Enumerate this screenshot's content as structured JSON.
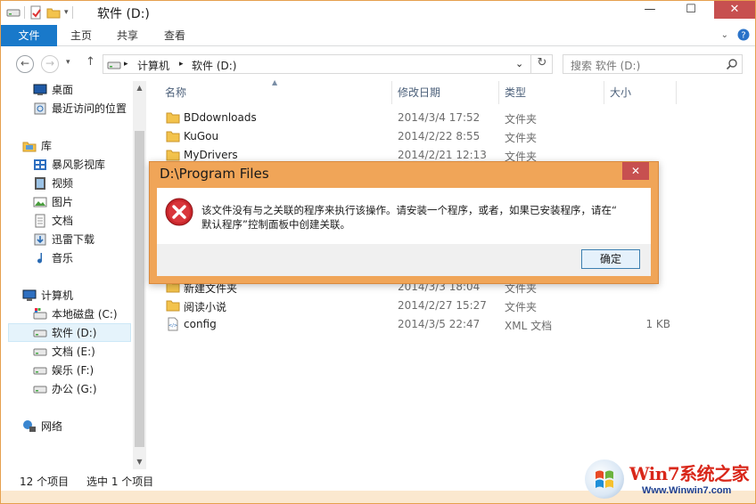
{
  "window": {
    "title": "软件 (D:)",
    "minimize_glyph": "—",
    "maximize_glyph": "☐",
    "close_glyph": "✕"
  },
  "ribbon": {
    "file_tab": "文件",
    "tabs": [
      "主页",
      "共享",
      "查看"
    ]
  },
  "address": {
    "path": [
      "计算机",
      "软件 (D:)"
    ],
    "search_placeholder": "搜索 软件 (D:)"
  },
  "nav": {
    "favorites": [
      {
        "label": "桌面",
        "icon": "desktop-icon"
      },
      {
        "label": "最近访问的位置",
        "icon": "recent-places-icon"
      }
    ],
    "library_header": "库",
    "libraries": [
      {
        "label": "暴风影视库",
        "icon": "video-library-icon"
      },
      {
        "label": "视频",
        "icon": "videos-icon"
      },
      {
        "label": "图片",
        "icon": "pictures-icon"
      },
      {
        "label": "文档",
        "icon": "documents-icon"
      },
      {
        "label": "迅雷下载",
        "icon": "downloads-icon"
      },
      {
        "label": "音乐",
        "icon": "music-icon"
      }
    ],
    "computer_header": "计算机",
    "drives": [
      {
        "label": "本地磁盘 (C:)",
        "icon": "system-drive-icon"
      },
      {
        "label": "软件 (D:)",
        "icon": "drive-icon",
        "selected": true
      },
      {
        "label": "文档 (E:)",
        "icon": "drive-icon"
      },
      {
        "label": "娱乐 (F:)",
        "icon": "drive-icon"
      },
      {
        "label": "办公 (G:)",
        "icon": "drive-icon"
      }
    ],
    "network_header": "网络"
  },
  "columns": {
    "name": "名称",
    "date": "修改日期",
    "type": "类型",
    "size": "大小"
  },
  "files": [
    {
      "name": "BDdownloads",
      "date": "2014/3/4 17:52",
      "type": "文件夹",
      "size": "",
      "icon": "folder-icon"
    },
    {
      "name": "KuGou",
      "date": "2014/2/22 8:55",
      "type": "文件夹",
      "size": "",
      "icon": "folder-icon"
    },
    {
      "name": "MyDrivers",
      "date": "2014/2/21 12:13",
      "type": "文件夹",
      "size": "",
      "icon": "folder-icon"
    },
    {
      "name": "新建文件夹",
      "date": "2014/3/3 18:04",
      "type": "文件夹",
      "size": "",
      "icon": "folder-icon"
    },
    {
      "name": "阅读小说",
      "date": "2014/2/27 15:27",
      "type": "文件夹",
      "size": "",
      "icon": "folder-icon"
    },
    {
      "name": "config",
      "date": "2014/3/5 22:47",
      "type": "XML 文档",
      "size": "1 KB",
      "icon": "xml-file-icon"
    }
  ],
  "status": {
    "count": "12 个项目",
    "selected": "选中 1 个项目"
  },
  "dialog": {
    "title": "D:\\Program Files",
    "message_line1": "该文件没有与之关联的程序来执行该操作。请安装一个程序，或者，如果已安装程序，请在“",
    "message_line2": "默认程序”控制面板中创建关联。",
    "ok_label": "确定",
    "close_glyph": "✕",
    "icon": "error-icon"
  },
  "watermark": {
    "brand": "Win7系统之家",
    "url": "Www.Winwin7.com"
  },
  "colors": {
    "accent": "#1979ca",
    "close_red": "#c75050",
    "dialog_frame": "#f0a558"
  }
}
